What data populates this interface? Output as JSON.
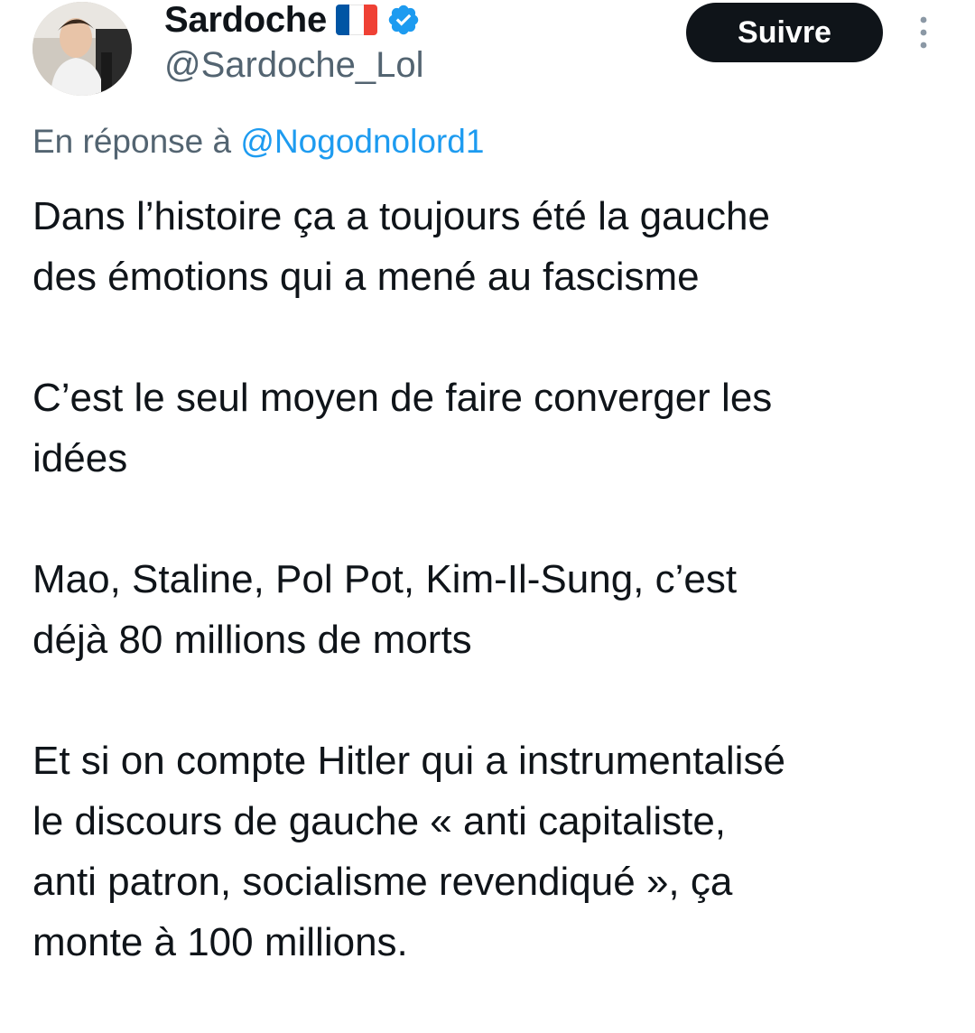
{
  "author": {
    "display_name": "Sardoche",
    "handle": "@Sardoche_Lol",
    "flag": "flag-france-icon",
    "verified": "verified-badge-icon",
    "verified_color": "#1d9bf0",
    "flag_colors": [
      "#0055a4",
      "#ffffff",
      "#ef4135"
    ]
  },
  "actions": {
    "follow_label": "Suivre",
    "more_icon": "more-vertical-icon"
  },
  "reply_context": {
    "prefix": "En réponse à",
    "mention": "@Nogodnolord1"
  },
  "tweet": {
    "paragraphs": [
      [
        "Dans l’histoire ça a toujours été la gauche",
        "des émotions qui a mené au fascisme"
      ],
      [
        "C’est le seul moyen de faire converger les",
        "idées"
      ],
      [
        "Mao, Staline, Pol Pot, Kim-Il-Sung, c’est",
        "déjà 80 millions de morts"
      ],
      [
        "Et si on compte Hitler qui a instrumentalisé",
        "le discours de gauche « anti capitaliste,",
        "anti patron, socialisme revendiqué », ça",
        "monte à 100 millions."
      ]
    ]
  },
  "colors": {
    "text_primary": "#0f1419",
    "text_secondary": "#536471",
    "accent": "#1d9bf0",
    "button_bg": "#0f1419"
  }
}
